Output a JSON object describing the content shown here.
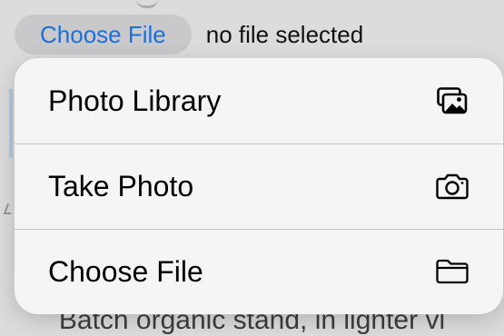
{
  "file_input": {
    "button_label": "Choose File",
    "status": "no file selected"
  },
  "menu": {
    "items": [
      {
        "label": "Photo Library",
        "icon": "photo-library-icon"
      },
      {
        "label": "Take Photo",
        "icon": "camera-icon"
      },
      {
        "label": "Choose File",
        "icon": "folder-icon"
      }
    ]
  },
  "background": {
    "bottom_text": "Batch organic stand, in lighter vl"
  },
  "colors": {
    "accent": "#1e6fd9",
    "menu_bg": "#f5f5f6",
    "separator": "#c6c6c8"
  }
}
